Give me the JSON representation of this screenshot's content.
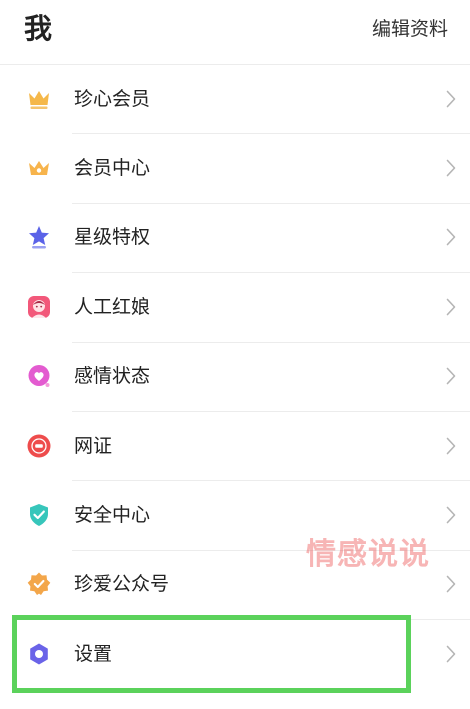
{
  "header": {
    "title": "我",
    "edit_label": "编辑资料"
  },
  "menu": {
    "items": [
      {
        "label": "珍心会员",
        "icon": "crown-icon",
        "color": "#f5b84a"
      },
      {
        "label": "会员中心",
        "icon": "crown-icon",
        "color": "#f7b44c"
      },
      {
        "label": "星级特权",
        "icon": "star-icon",
        "color": "#5b63e8"
      },
      {
        "label": "人工红娘",
        "icon": "matchmaker-icon",
        "color": "#f2587a"
      },
      {
        "label": "感情状态",
        "icon": "heart-icon",
        "color": "#e35bd0"
      },
      {
        "label": "网证",
        "icon": "id-badge-icon",
        "color": "#ee4c4c"
      },
      {
        "label": "安全中心",
        "icon": "shield-check-icon",
        "color": "#37c6bb"
      },
      {
        "label": "珍爱公众号",
        "icon": "badge-check-icon",
        "color": "#f3a64a"
      },
      {
        "label": "设置",
        "icon": "gear-icon",
        "color": "#6a63e8"
      }
    ]
  },
  "watermark": "情感说说",
  "highlight_color": "#5bd25b"
}
